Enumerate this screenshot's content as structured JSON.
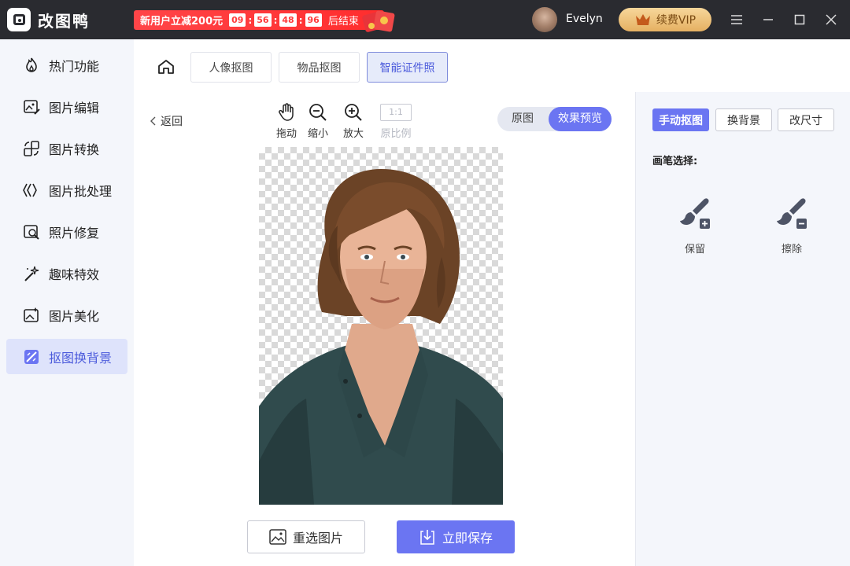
{
  "app": {
    "title": "改图鸭"
  },
  "promo": {
    "text": "新用户立减200元",
    "countdown": [
      "09",
      "56",
      "48",
      "96"
    ],
    "suffix": "后结束"
  },
  "user": {
    "name": "Evelyn",
    "vip_label": "续费VIP"
  },
  "sidebar": {
    "items": [
      {
        "label": "热门功能",
        "icon": "fire-icon"
      },
      {
        "label": "图片编辑",
        "icon": "image-edit-icon"
      },
      {
        "label": "图片转换",
        "icon": "convert-icon"
      },
      {
        "label": "图片批处理",
        "icon": "batch-icon"
      },
      {
        "label": "照片修复",
        "icon": "photo-repair-icon"
      },
      {
        "label": "趣味特效",
        "icon": "magic-wand-icon"
      },
      {
        "label": "图片美化",
        "icon": "image-beautify-icon"
      },
      {
        "label": "抠图换背景",
        "icon": "cutout-icon",
        "active": true
      }
    ]
  },
  "tabs": [
    {
      "label": "人像抠图"
    },
    {
      "label": "物品抠图"
    },
    {
      "label": "智能证件照",
      "active": true
    }
  ],
  "toolbar": {
    "back": "返回",
    "drag": "拖动",
    "zoom_out": "缩小",
    "zoom_in": "放大",
    "ratio_value": "1:1",
    "ratio": "原比例"
  },
  "view_toggle": {
    "original": "原图",
    "preview": "效果预览"
  },
  "actions": {
    "reselect": "重选图片",
    "save": "立即保存"
  },
  "right_panel": {
    "tabs": [
      {
        "label": "手动抠图",
        "active": true
      },
      {
        "label": "换背景"
      },
      {
        "label": "改尺寸"
      }
    ],
    "brush_label": "画笔选择:",
    "brush_keep": "保留",
    "brush_erase": "擦除"
  },
  "colors": {
    "accent": "#6b75f2",
    "titlebar": "#2a2b30",
    "promo": "#ff3b3b",
    "vip": "#e5b062"
  }
}
